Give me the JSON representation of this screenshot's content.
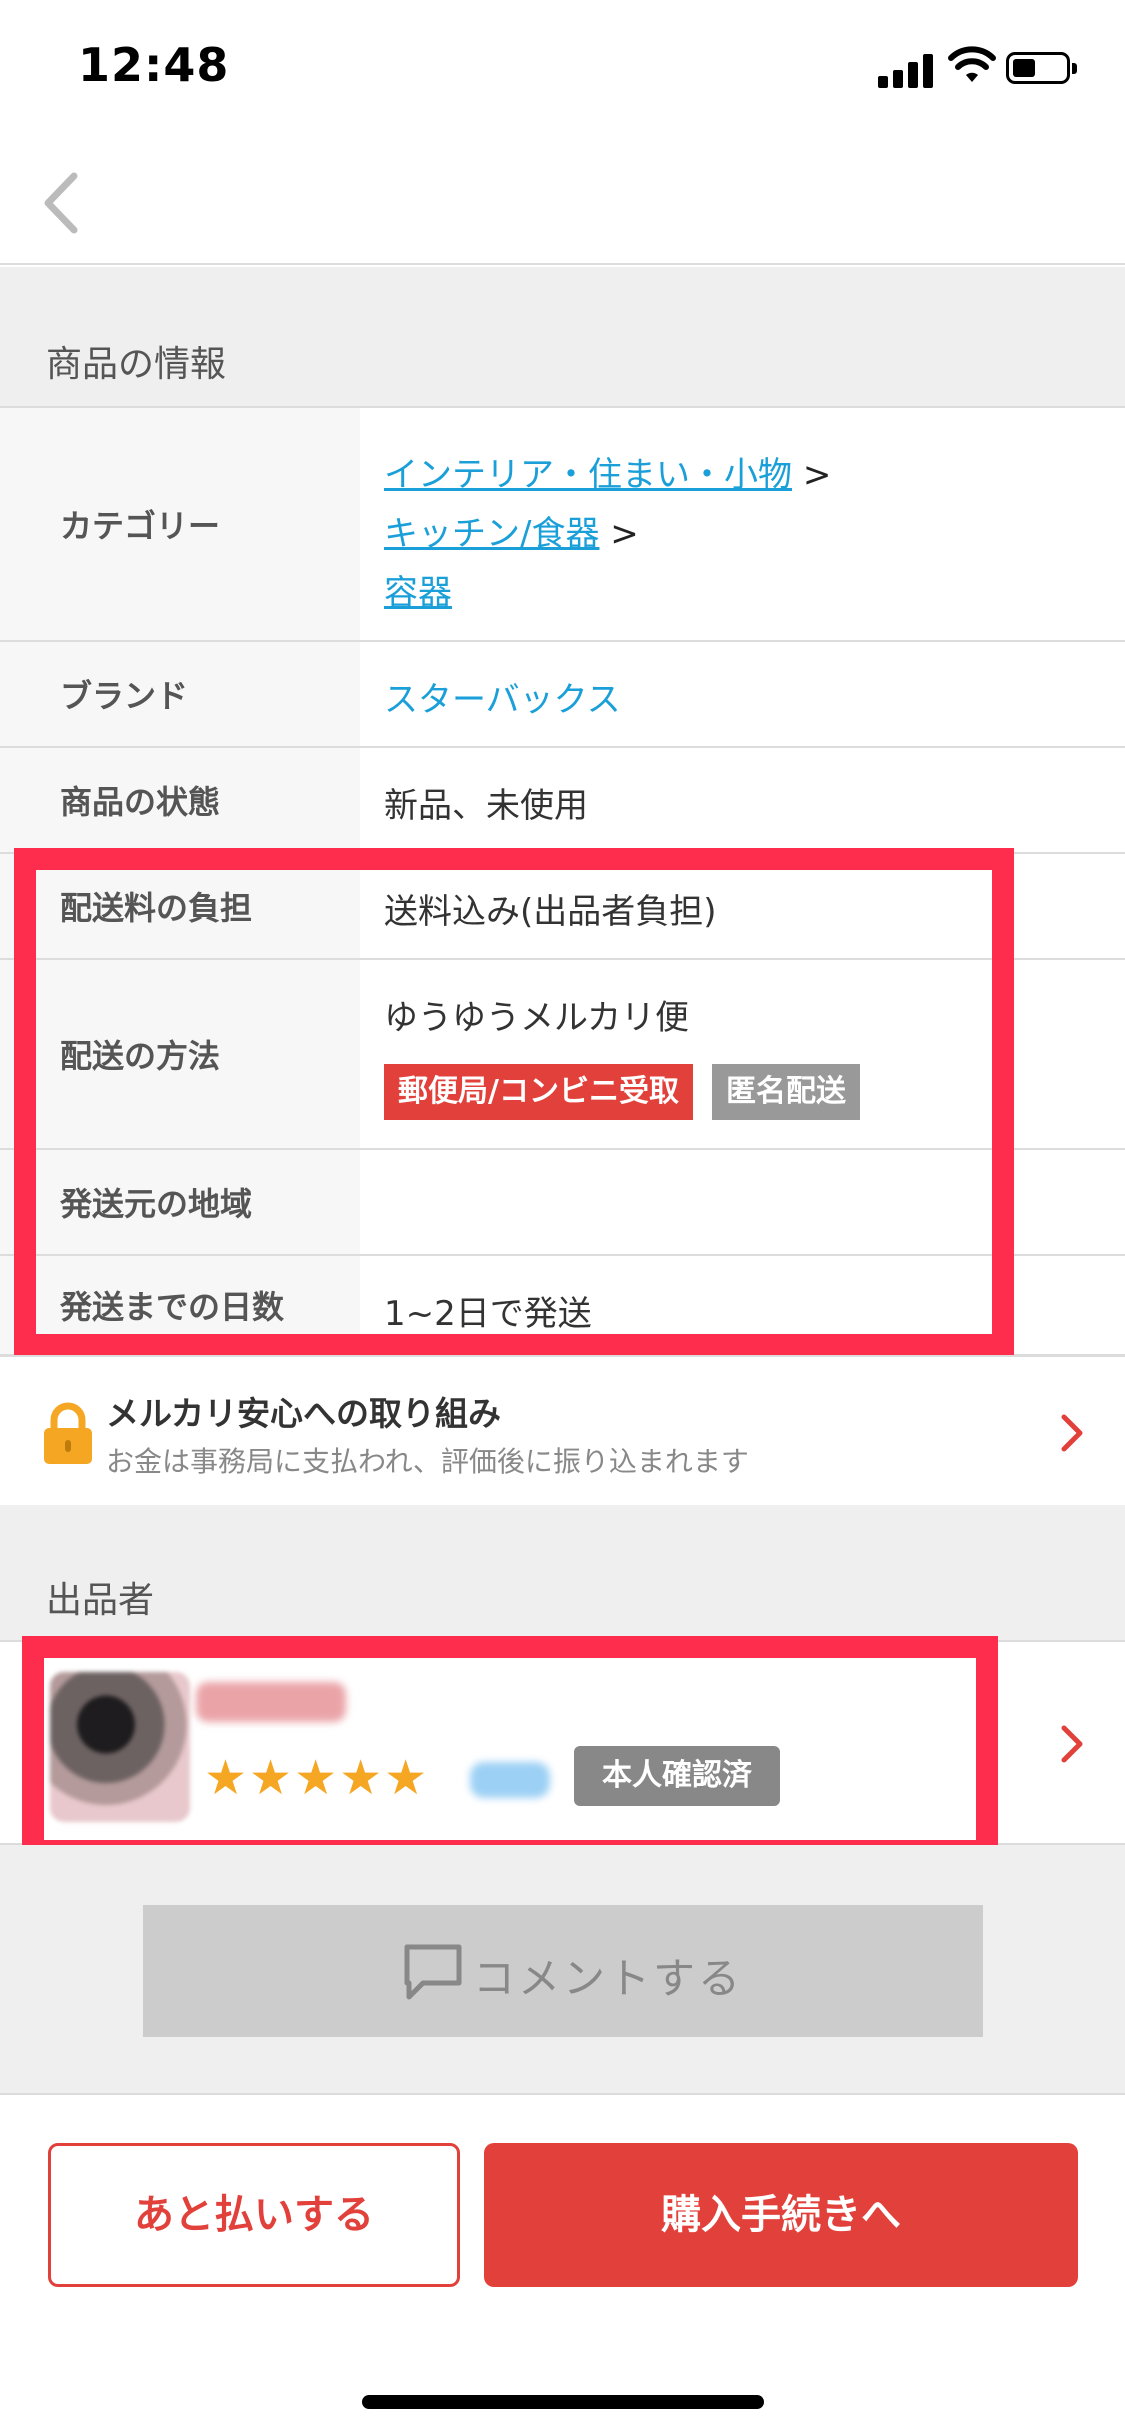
{
  "status_bar": {
    "time": "12:48"
  },
  "section_product": {
    "title": "商品の情報"
  },
  "details": {
    "category": {
      "label": "カテゴリー",
      "items": [
        "インテリア・住まい・小物",
        "キッチン/食器",
        "容器"
      ],
      "separator": ">"
    },
    "brand": {
      "label": "ブランド",
      "value": "スターバックス"
    },
    "condition": {
      "label": "商品の状態",
      "value": "新品、未使用"
    },
    "shipping_fee": {
      "label": "配送料の負担",
      "value": "送料込み(出品者負担)"
    },
    "shipping_method": {
      "label": "配送の方法",
      "value": "ゆうゆうメルカリ便",
      "tags": [
        "郵便局/コンビニ受取",
        "匿名配送"
      ]
    },
    "ship_from": {
      "label": "発送元の地域",
      "value": ""
    },
    "ship_days": {
      "label": "発送までの日数",
      "value": "1~2日で発送"
    }
  },
  "safety": {
    "title": "メルカリ安心への取り組み",
    "subtitle": "お金は事務局に支払われ、評価後に振り込まれます"
  },
  "section_seller": {
    "title": "出品者"
  },
  "seller": {
    "rating": 5,
    "stars": "★★★★★",
    "verified_badge": "本人確認済"
  },
  "comment_button": {
    "label": "コメントする"
  },
  "actions": {
    "pay_later": "あと払いする",
    "purchase": "購入手続きへ"
  },
  "colors": {
    "accent": "#e2403a",
    "highlight": "#ff2d4d",
    "link": "#1a9fd9",
    "star": "#f5a623"
  }
}
